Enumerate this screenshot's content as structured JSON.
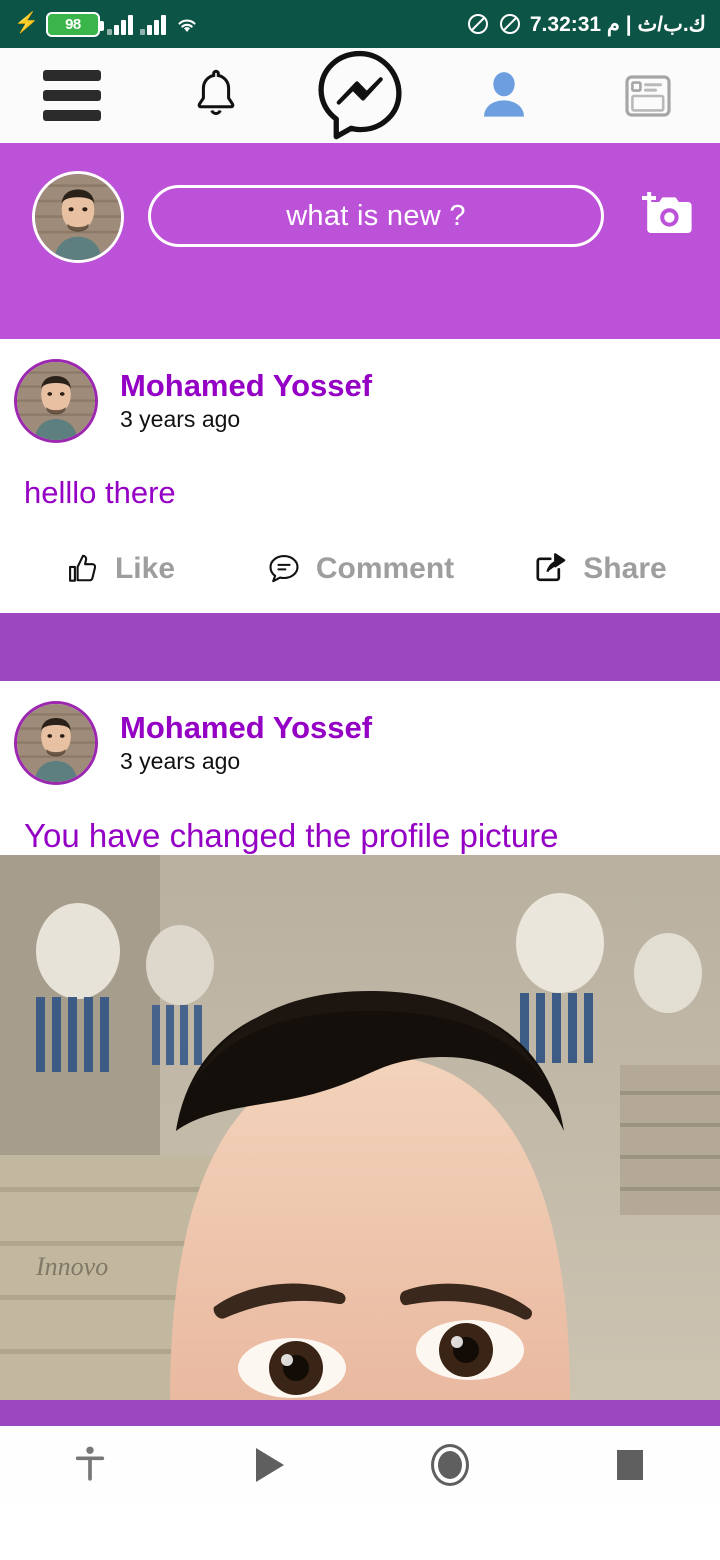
{
  "status_bar": {
    "background_color": "#0b5446",
    "charging_icon": "bolt-icon",
    "battery_level": "98",
    "signal_icon": "signal-bars-icon",
    "wifi_icon": "wifi-icon",
    "mute_icon_1": "mute-circle-icon",
    "mute_icon_2": "mute-circle-icon",
    "data_rate_and_time": "7.3ك.ب/ث | م 2:31"
  },
  "top_nav": {
    "menu": "hamburger-menu-icon",
    "notifications": "bell-icon",
    "messenger": "messenger-bolt-icon",
    "profile": "person-avatar-icon",
    "feed": "news-card-icon"
  },
  "composer": {
    "background_color": "#bc52d8",
    "avatar": "user-avatar",
    "placeholder": "what is new ?",
    "camera": "add-photo-camera-icon"
  },
  "posts": [
    {
      "author": "Mohamed Yossef",
      "time": "3 years ago",
      "body": "helllo there",
      "has_photo": false,
      "actions": [
        {
          "label": "Like",
          "icon": "thumbs-up-icon"
        },
        {
          "label": "Comment",
          "icon": "comment-bubble-icon"
        },
        {
          "label": "Share",
          "icon": "share-arrow-icon"
        }
      ]
    },
    {
      "author": "Mohamed Yossef",
      "time": "3 years ago",
      "body": "You have changed the profile picture",
      "has_photo": true,
      "photo_description": "selfie-in-egyptian-temple",
      "photo_watermark": "Innovo"
    }
  ],
  "system_nav": {
    "accessibility": "accessibility-icon",
    "back": "back-triangle-icon",
    "home": "home-circle-icon",
    "recents": "recents-square-icon"
  },
  "colors": {
    "accent_purple": "#bc52d8",
    "band_purple": "#9b47bf",
    "text_purple": "#9400c4",
    "status_green": "#0b5446",
    "action_gray": "#9e9e9e"
  }
}
